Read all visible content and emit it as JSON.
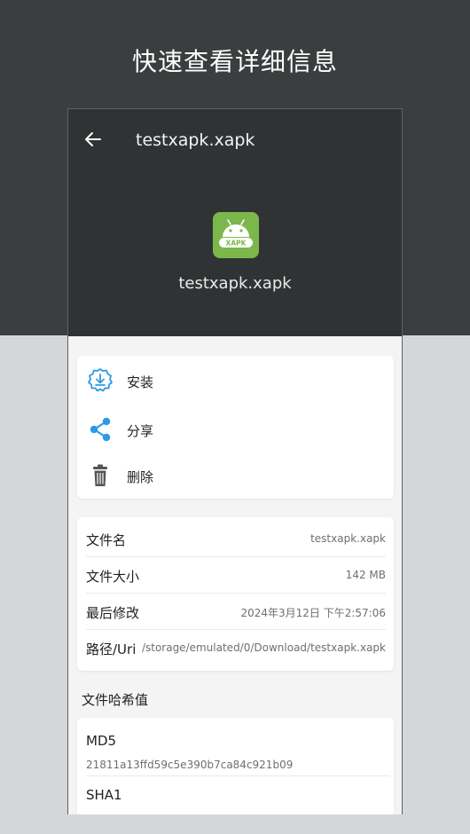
{
  "promo_title": "快速查看详细信息",
  "colors": {
    "dark_bg": "#3a3e3f",
    "app_bar": "#303334",
    "android_green": "#7cb74b",
    "accent_blue": "#2b9ae6",
    "light_bg": "#d5d6d8"
  },
  "appbar": {
    "back_icon": "arrow-left-icon",
    "title": "testxapk.xapk"
  },
  "file": {
    "icon": "android-xapk-icon",
    "icon_text": "XAPK",
    "name": "testxapk.xapk"
  },
  "actions": [
    {
      "icon": "install-download-icon",
      "label": "安装"
    },
    {
      "icon": "share-icon",
      "label": "分享"
    },
    {
      "icon": "trash-icon",
      "label": "删除"
    }
  ],
  "info": [
    {
      "key": "文件名",
      "value": "testxapk.xapk"
    },
    {
      "key": "文件大小",
      "value": "142 MB"
    },
    {
      "key": "最后修改",
      "value": "2024年3月12日 下午2:57:06"
    },
    {
      "key": "路径/Uri",
      "value": "/storage/emulated/0/Download/testxapk.xapk"
    }
  ],
  "hash_section": {
    "title": "文件哈希值",
    "items": [
      {
        "algo": "MD5",
        "value": "21811a13ffd59c5e390b7ca84c921b09"
      },
      {
        "algo": "SHA1",
        "value": ""
      }
    ]
  }
}
